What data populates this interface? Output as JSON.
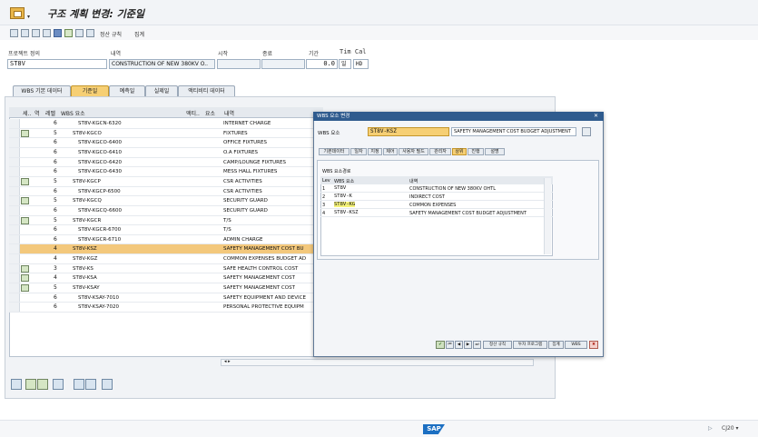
{
  "window": {
    "title": "구조 계획 변경: 기준일"
  },
  "toolbar": {
    "settle_rule": "정산 규칙",
    "total": "집계"
  },
  "project": {
    "label_def": "프로젝트 정의",
    "label_desc": "내역",
    "label_start": "시작",
    "label_end": "종료",
    "label_period": "기간",
    "label_timecal": "Tim Cal",
    "def_value": "ST8V",
    "desc_value": "CONSTRUCTION OF NEW 380KV O..",
    "period_value": "0.0",
    "period_unit": "일",
    "cal_value": "HD"
  },
  "tabs": [
    "WBS 기본 데이터",
    "기준일",
    "예측일",
    "실제일",
    "액티비티 데이터"
  ],
  "table": {
    "headers": {
      "sel": "세..",
      "col2": "역",
      "level": "레벨",
      "wbs": "WBS 요소",
      "act": "액티..",
      "elem": "요소",
      "desc": "내역"
    },
    "rows": [
      {
        "level": "6",
        "wbs": "ST8V-KGCN-6320",
        "desc": "INTERNET CHARGE",
        "flag": false,
        "hl": false
      },
      {
        "level": "5",
        "wbs": "ST8V-KGCO",
        "desc": "FIXTURES",
        "flag": true,
        "hl": false
      },
      {
        "level": "6",
        "wbs": "ST8V-KGCO-6400",
        "desc": "OFFICE FIXTURES",
        "flag": false,
        "hl": false
      },
      {
        "level": "6",
        "wbs": "ST8V-KGCO-6410",
        "desc": "O.A FIXTURES",
        "flag": false,
        "hl": false
      },
      {
        "level": "6",
        "wbs": "ST8V-KGCO-6420",
        "desc": "CAMP/LOUNGE FIXTURES",
        "flag": false,
        "hl": false
      },
      {
        "level": "6",
        "wbs": "ST8V-KGCO-6430",
        "desc": "MESS HALL FIXTURES",
        "flag": false,
        "hl": false
      },
      {
        "level": "5",
        "wbs": "ST8V-KGCP",
        "desc": "CSR ACTIVITIES",
        "flag": true,
        "hl": false
      },
      {
        "level": "6",
        "wbs": "ST8V-KGCP-6500",
        "desc": "CSR ACTIVITIES",
        "flag": false,
        "hl": false
      },
      {
        "level": "5",
        "wbs": "ST8V-KGCQ",
        "desc": "SECURITY GUARD",
        "flag": true,
        "hl": false
      },
      {
        "level": "6",
        "wbs": "ST8V-KGCQ-6600",
        "desc": "SECURITY GUARD",
        "flag": false,
        "hl": false
      },
      {
        "level": "5",
        "wbs": "ST8V-KGCR",
        "desc": "T/S",
        "flag": true,
        "hl": false
      },
      {
        "level": "6",
        "wbs": "ST8V-KGCR-6700",
        "desc": "T/S",
        "flag": false,
        "hl": false
      },
      {
        "level": "6",
        "wbs": "ST8V-KGCR-6710",
        "desc": "ADMIN CHARGE",
        "flag": false,
        "hl": false
      },
      {
        "level": "4",
        "wbs": "ST8V-KSZ",
        "desc": "SAFETY MANAGEMENT COST BU",
        "flag": false,
        "hl": true
      },
      {
        "level": "4",
        "wbs": "ST8V-KGZ",
        "desc": "COMMON EXPENSES BUDGET AD",
        "flag": false,
        "hl": false
      },
      {
        "level": "3",
        "wbs": "ST8V-KS",
        "desc": "SAFE HEALTH CONTROL COST",
        "flag": true,
        "hl": false
      },
      {
        "level": "4",
        "wbs": "ST8V-KSA",
        "desc": "SAFETY MANAGEMENT COST",
        "flag": true,
        "hl": false
      },
      {
        "level": "5",
        "wbs": "ST8V-KSAY",
        "desc": "SAFETY MANAGEMENT COST",
        "flag": true,
        "hl": false
      },
      {
        "level": "6",
        "wbs": "ST8V-KSAY-7010",
        "desc": "SAFETY EQUIPMENT AND DEVICE",
        "flag": false,
        "hl": false
      },
      {
        "level": "6",
        "wbs": "ST8V-KSAY-7020",
        "desc": "PERSONAL PROTECTIVE EQUIPM",
        "flag": false,
        "hl": false
      }
    ]
  },
  "dialog": {
    "title": "WBS 요소 변경",
    "field_label": "WBS 요소",
    "wbs_value": "ST8V-KSZ",
    "wbs_desc": "SAFETY MANAGEMENT COST BUDGET ADJUSTMENT",
    "tabs": [
      "기본데이터",
      "일자",
      "지정",
      "제어",
      "사용자 필드",
      "관리자",
      "상위",
      "진행",
      "설명"
    ],
    "group_title": "WBS 요소경로",
    "cols": {
      "lev": "Lev",
      "wbs": "WBS 요소",
      "desc": "내역"
    },
    "rows": [
      {
        "lev": "1",
        "wbs": "ST8V",
        "desc": "CONSTRUCTION OF NEW 380KV OHTL"
      },
      {
        "lev": "2",
        "wbs": "ST8V-K",
        "desc": "INDIRECT COST"
      },
      {
        "lev": "3",
        "wbs": "ST8V-KG",
        "desc": "COMMON EXPENSES"
      },
      {
        "lev": "4",
        "wbs": "ST8V-KSZ",
        "desc": "SAFETY MANAGEMENT COST BUDGET ADJUSTMENT"
      }
    ],
    "footer": {
      "settle": "정산 규칙",
      "invest": "투자 프로그램",
      "total": "집계",
      "wbs": "WBS"
    }
  },
  "status": {
    "sap": "SAP",
    "tcode": "CJ20"
  }
}
